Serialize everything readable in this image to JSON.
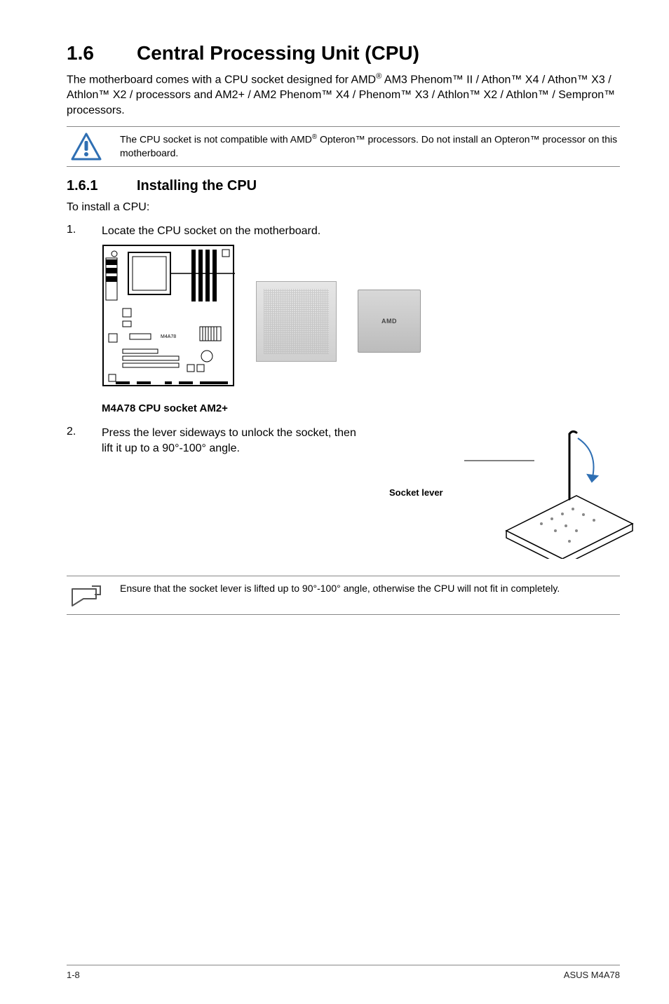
{
  "heading": {
    "num": "1.6",
    "title": "Central Processing Unit (CPU)"
  },
  "intro": {
    "pre": "The motherboard comes with a CPU socket designed for AMD",
    "reg1": "®",
    "post": " AM3 Phenom™ II / Athon™ X4 / Athon™ X3 / Athlon™ X2 / processors and AM2+ / AM2 Phenom™ X4 / Phenom™ X3 / Athlon™ X2 / Athlon™ / Sempron™ processors."
  },
  "warn": {
    "pre": "The CPU socket is not compatible with AMD",
    "reg": "®",
    "post": " Opteron™ processors. Do not install an Opteron™ processor on this motherboard."
  },
  "sub": {
    "num": "1.6.1",
    "title": "Installing the CPU"
  },
  "lead": "To install a CPU:",
  "step1": {
    "n": "1.",
    "t": "Locate the CPU socket on the motherboard."
  },
  "fig1_caption": "M4A78 CPU socket AM2+",
  "cpu_brand": "AMD",
  "step2": {
    "n": "2.",
    "t": "Press the lever sideways to unlock the socket, then lift it up to a 90°-100° angle."
  },
  "socket_lever_label": "Socket lever",
  "note2": "Ensure that the socket lever is lifted up to 90°-100° angle, otherwise the CPU will not fit in completely.",
  "footer": {
    "left": "1-8",
    "right": "ASUS M4A78"
  }
}
